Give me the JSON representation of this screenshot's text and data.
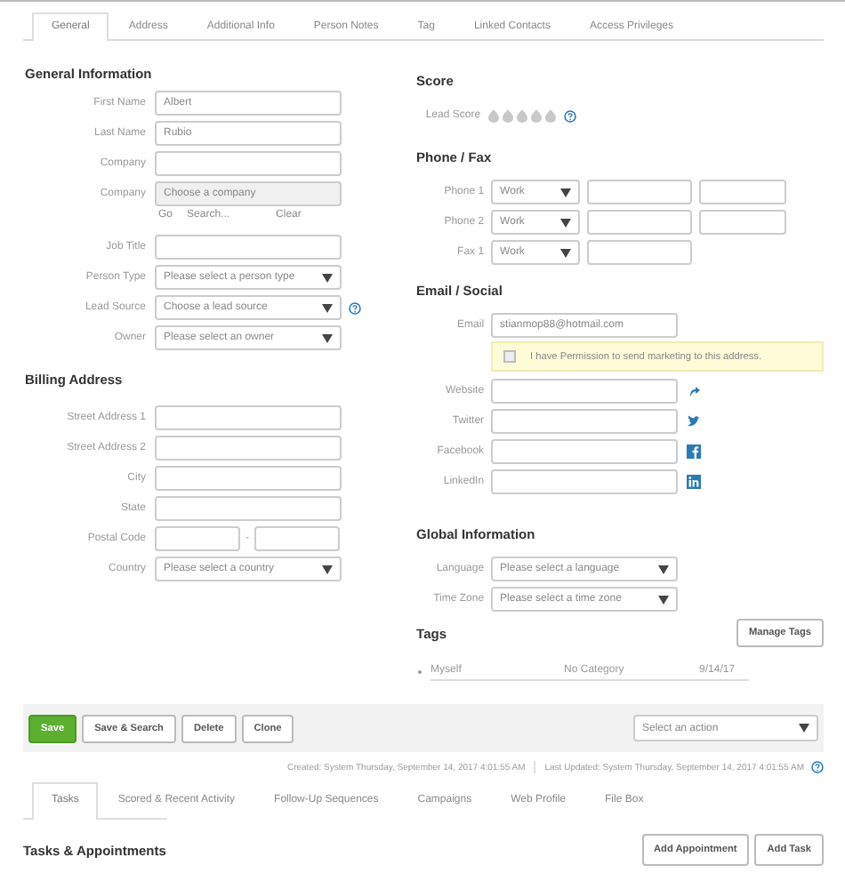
{
  "tabs": [
    {
      "label": "General",
      "selected": true
    },
    {
      "label": "Address",
      "selected": false
    },
    {
      "label": "Additional Info",
      "selected": false
    },
    {
      "label": "Person Notes",
      "selected": false
    },
    {
      "label": "Tag",
      "selected": false
    },
    {
      "label": "Linked Contacts",
      "selected": false
    },
    {
      "label": "Access Privileges",
      "selected": false
    }
  ],
  "general_information": {
    "title": "General Information",
    "fields": [
      {
        "kind": "input",
        "label": "First Name",
        "value": "Albert"
      },
      {
        "kind": "input",
        "label": "Last Name",
        "value": "Rubio"
      },
      {
        "kind": "input",
        "label": "Company"
      },
      {
        "kind": "disabled",
        "label": "Company",
        "placeholder": "Choose a company"
      },
      {
        "kind": "links",
        "links": [
          "Go",
          "Search...",
          "Clear"
        ]
      },
      {
        "kind": "input",
        "label": "Job Title"
      },
      {
        "kind": "select",
        "label": "Person Type",
        "placeholder": "Please select a person type"
      },
      {
        "kind": "select",
        "label": "Lead Source",
        "placeholder": "Choose a lead source",
        "help": true
      },
      {
        "kind": "select",
        "label": "Owner",
        "placeholder": "Please select an owner"
      }
    ]
  },
  "billing_address": {
    "title": "Billing Address",
    "fields": [
      {
        "kind": "input",
        "label": "Street Address 1"
      },
      {
        "kind": "input",
        "label": "Street Address 2"
      },
      {
        "kind": "input",
        "label": "City"
      },
      {
        "kind": "input",
        "label": "State"
      },
      {
        "kind": "postal",
        "label": "Postal Code",
        "separator": "-"
      },
      {
        "kind": "select",
        "label": "Country",
        "placeholder": "Please select a country"
      }
    ]
  },
  "score": {
    "title": "Score",
    "label": "Lead Score",
    "stars": 0
  },
  "phone_fax": {
    "title": "Phone / Fax",
    "rows": [
      {
        "label": "Phone 1",
        "type": "Work",
        "extension": true
      },
      {
        "label": "Phone 2",
        "type": "Work",
        "extension": true
      },
      {
        "label": "Fax 1",
        "type": "Work",
        "extension": false
      }
    ]
  },
  "email_social": {
    "title": "Email / Social",
    "email_label": "Email",
    "email": "stianmop88@hotmail.com",
    "permission": {
      "label": "I have Permission to send marketing to this address.",
      "checked": false
    },
    "social": [
      {
        "kind": "website",
        "label": "Website"
      },
      {
        "kind": "twitter",
        "label": "Twitter"
      },
      {
        "kind": "facebook",
        "label": "Facebook"
      },
      {
        "kind": "linkedin",
        "label": "LinkedIn"
      }
    ]
  },
  "global_information": {
    "title": "Global Information",
    "fields": [
      {
        "label": "Language",
        "placeholder": "Please select a language"
      },
      {
        "label": "Time Zone",
        "placeholder": "Please select a time zone"
      }
    ]
  },
  "tags": {
    "title": "Tags",
    "button": "Manage Tags",
    "rows": [
      {
        "name": "Myself",
        "category": "No Category",
        "date": "9/14/17"
      }
    ]
  },
  "actions": {
    "buttons": [
      {
        "label": "Save",
        "kind": "primary"
      },
      {
        "label": "Save & Search",
        "kind": "default"
      },
      {
        "label": "Delete",
        "kind": "default"
      },
      {
        "label": "Clone",
        "kind": "default"
      }
    ],
    "select_placeholder": "Select an action"
  },
  "audit": {
    "created": "Created: System Thursday, September 14, 2017 4:01:55 AM",
    "updated": "Last Updated: System Thursday, September 14, 2017 4:01:55 AM"
  },
  "bottom_tabs": [
    {
      "label": "Tasks",
      "selected": true
    },
    {
      "label": "Scored & Recent Activity",
      "selected": false
    },
    {
      "label": "Follow-Up Sequences",
      "selected": false
    },
    {
      "label": "Campaigns",
      "selected": false
    },
    {
      "label": "Web Profile",
      "selected": false
    },
    {
      "label": "File Box",
      "selected": false
    }
  ],
  "tasks": {
    "title": "Tasks & Appointments",
    "buttons": [
      "Add Appointment",
      "Add Task"
    ]
  }
}
